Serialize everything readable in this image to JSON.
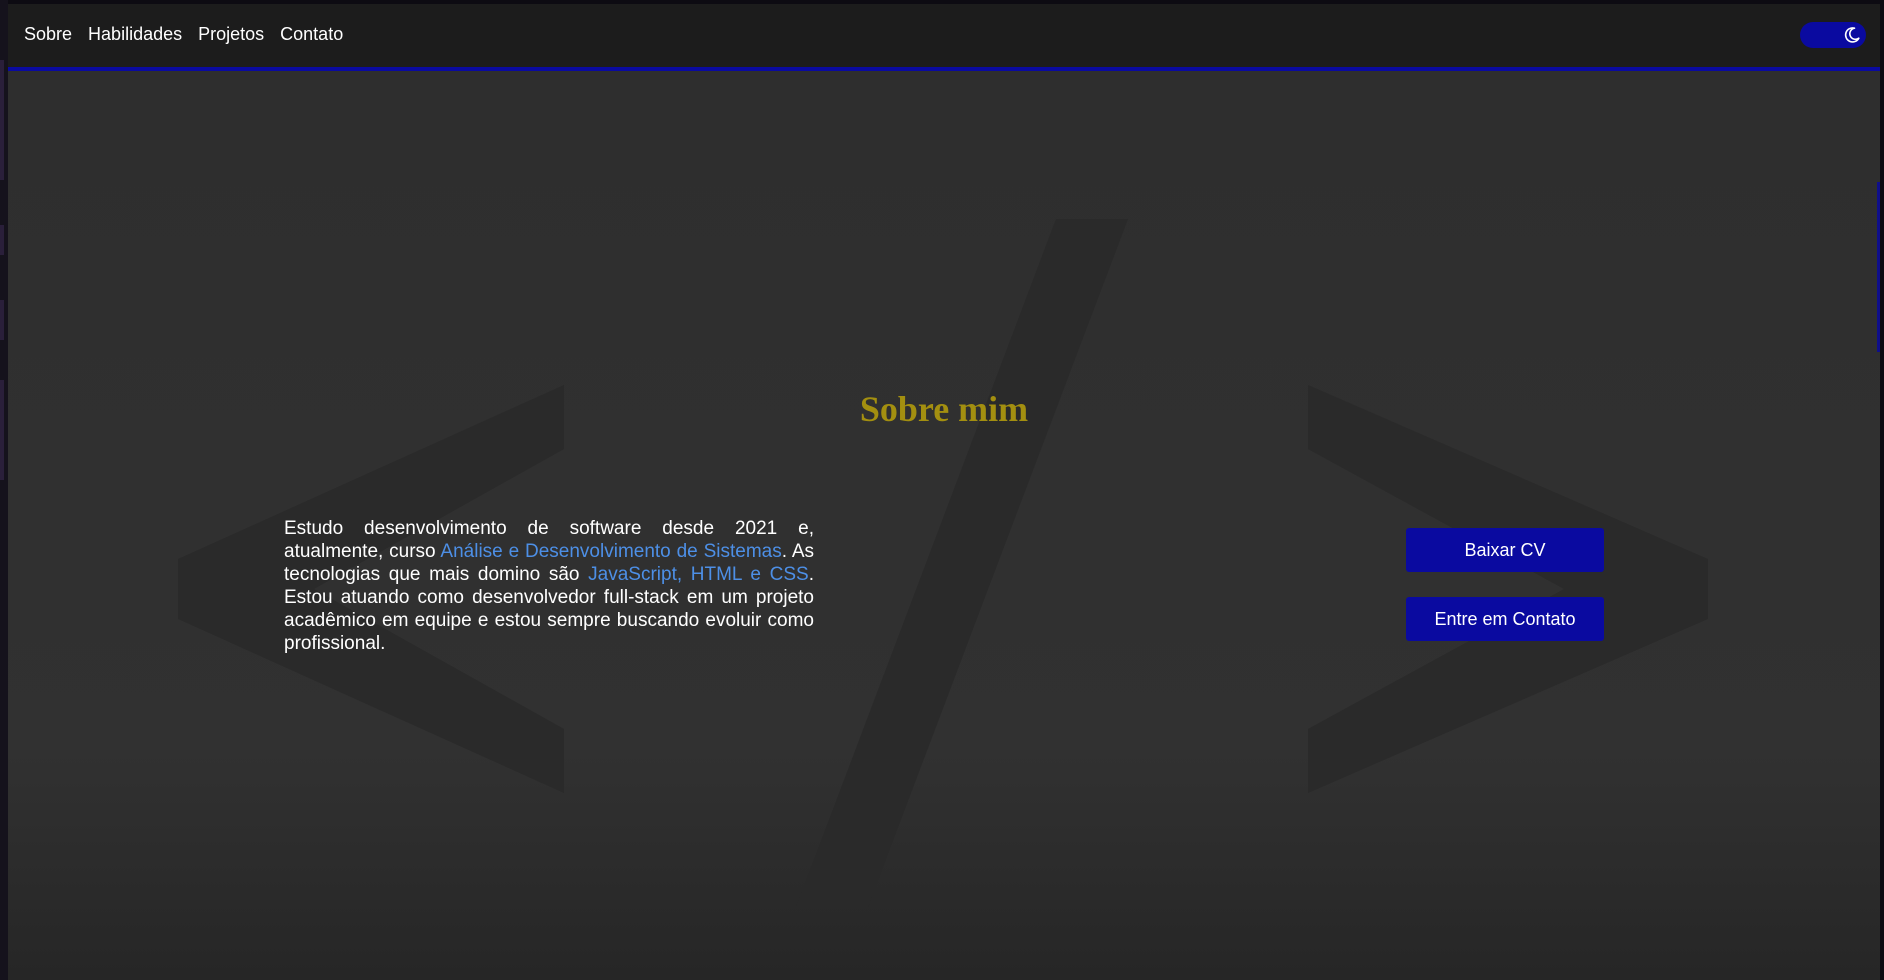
{
  "nav": {
    "links": [
      "Sobre",
      "Habilidades",
      "Projetos",
      "Contato"
    ]
  },
  "theme_toggle": {
    "icon": "moon-icon",
    "accent": "#0a0aa0"
  },
  "about": {
    "title": "Sobre mim",
    "text_parts": [
      "Estudo desenvolvimento de software desde 2021 e, atualmente, curso ",
      "Análise e Desenvolvimento de Sistemas",
      ". As tecnologias que mais domino são ",
      "JavaScript, HTML e CSS",
      ". Estou atuando como desenvolvedor full-stack em um projeto acadêmico em equipe e estou sempre buscando evoluir como profissional."
    ],
    "buttons": {
      "download_cv": "Baixar CV",
      "contact": "Entre em Contato"
    }
  },
  "colors": {
    "title": "#a38f10",
    "highlight": "#4d8fe6",
    "button": "#0a0aa0",
    "nav_border": "#0a0aa0",
    "background": "#2e2e2e"
  }
}
